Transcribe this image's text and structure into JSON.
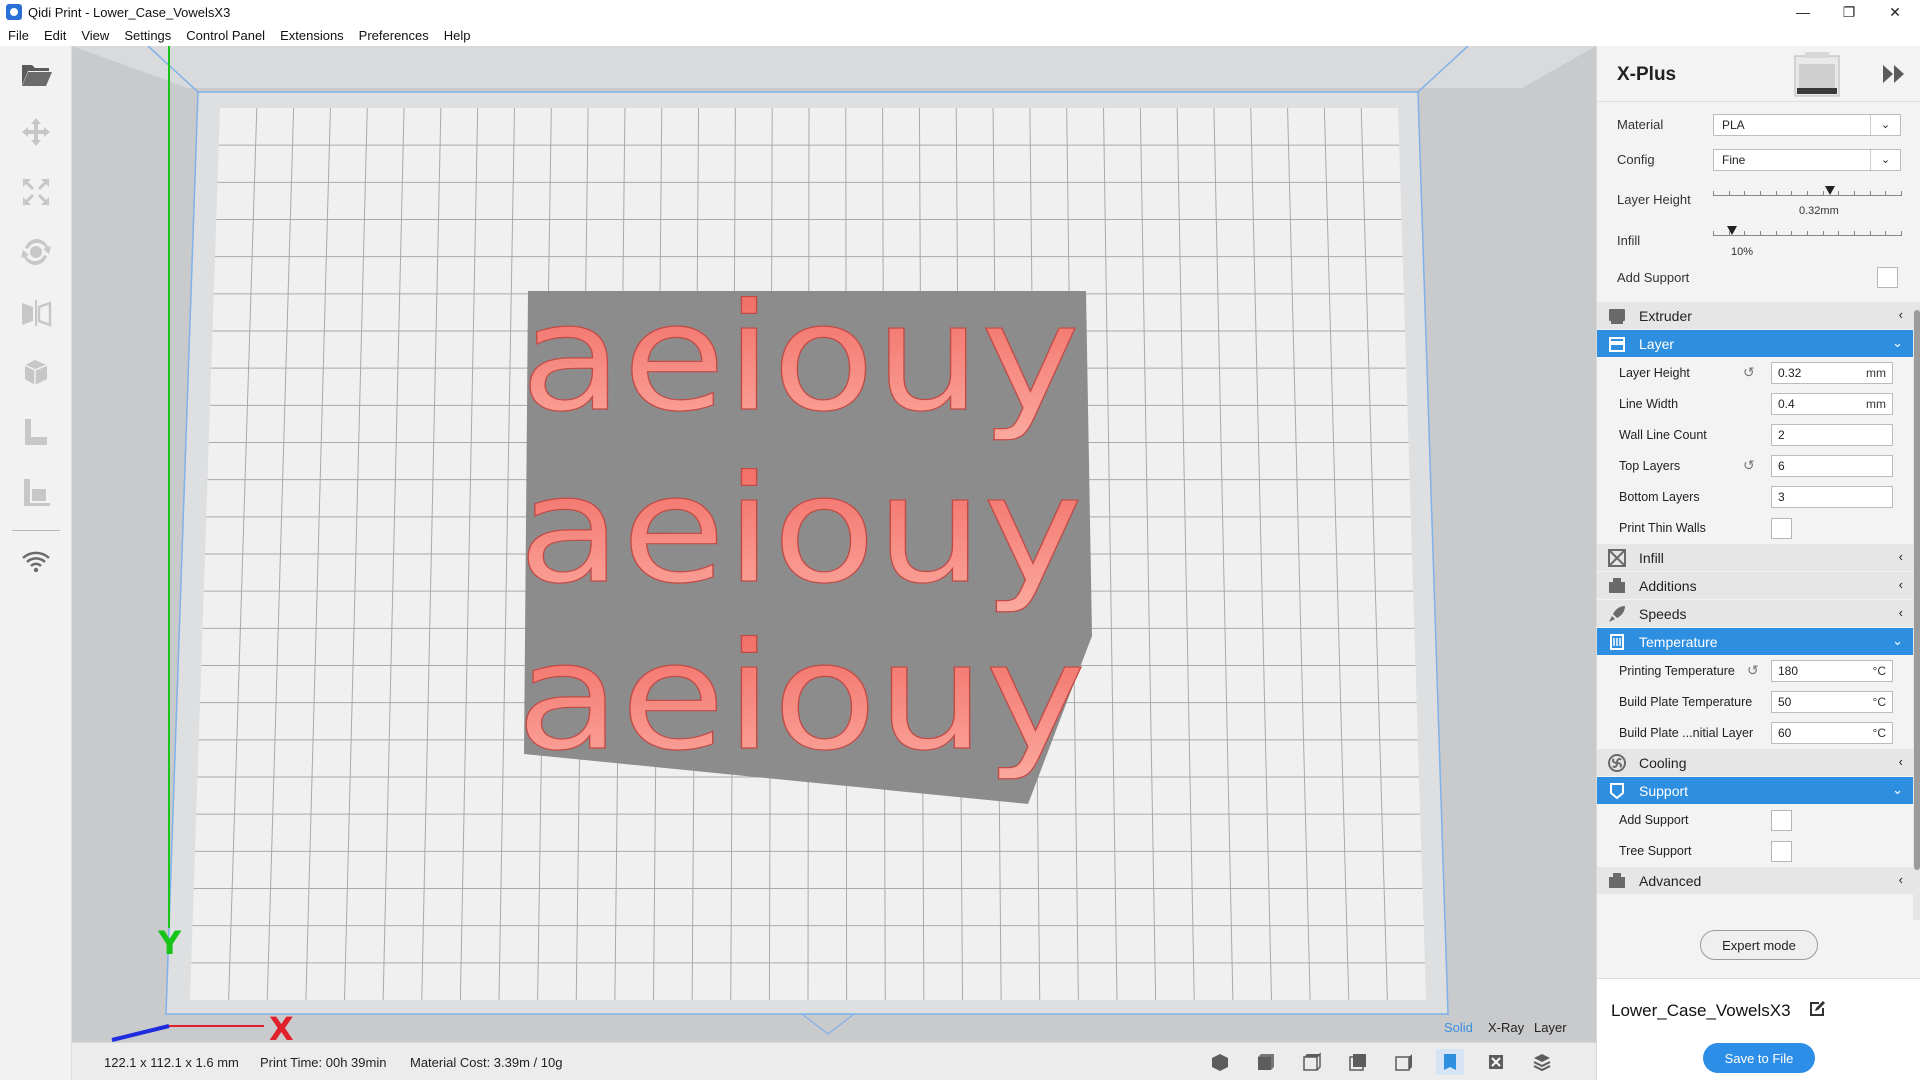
{
  "window": {
    "title": "Qidi Print - Lower_Case_VowelsX3",
    "minimize": "—",
    "maximize": "❐",
    "close": "✕"
  },
  "menu": [
    "File",
    "Edit",
    "View",
    "Settings",
    "Control Panel",
    "Extensions",
    "Preferences",
    "Help"
  ],
  "left_toolbar": [
    "open-folder-icon",
    "move-icon",
    "scale-icon",
    "rotate-icon",
    "mirror-icon",
    "per-model-settings-icon",
    "support-blocker-icon",
    "lay-flat-icon",
    "wifi-icon"
  ],
  "scene": {
    "model_text_rows": [
      "aeiouy",
      "aeiouy",
      "aeiouy"
    ],
    "axis_y_label": "Y",
    "axis_x_label": "X",
    "colors": {
      "model_base": "#8c8c8c",
      "model_text": "#f1665e",
      "axis_y": "#19c419",
      "axis_x": "#e0202a",
      "axis_z": "#1e2ce0",
      "build_volume_edge": "#6fa5e6"
    }
  },
  "view_modes": {
    "solid": "Solid",
    "xray": "X-Ray",
    "layer": "Layer"
  },
  "status": {
    "dimensions": "122.1 x 112.1 x 1.6 mm",
    "print_time": "Print Time: 00h 39min",
    "material_cost": "Material Cost: 3.39m / 10g"
  },
  "camera_buttons": [
    "3d-view-icon",
    "front-view-icon",
    "top-view-icon",
    "left-view-icon",
    "right-view-icon",
    "solid-view-icon",
    "xray-view-icon",
    "layer-view-icon"
  ],
  "panel": {
    "printer": "X-Plus",
    "basic": {
      "material_label": "Material",
      "material_value": "PLA",
      "config_label": "Config",
      "config_value": "Fine",
      "layer_height_label": "Layer Height",
      "layer_height_value": "0.32mm",
      "layer_height_fraction": 0.62,
      "infill_label": "Infill",
      "infill_value": "10%",
      "infill_fraction": 0.1,
      "add_support_label": "Add Support"
    },
    "categories": {
      "extruder": "Extruder",
      "layer": "Layer",
      "infill": "Infill",
      "additions": "Additions",
      "speeds": "Speeds",
      "temperature": "Temperature",
      "cooling": "Cooling",
      "support": "Support",
      "advanced": "Advanced"
    },
    "layer_settings": [
      {
        "label": "Layer Height",
        "value": "0.32",
        "unit": "mm"
      },
      {
        "label": "Line Width",
        "value": "0.4",
        "unit": "mm"
      },
      {
        "label": "Wall Line Count",
        "value": "2",
        "unit": ""
      },
      {
        "label": "Top Layers",
        "value": "6",
        "unit": ""
      },
      {
        "label": "Bottom Layers",
        "value": "3",
        "unit": ""
      },
      {
        "label": "Print Thin Walls"
      }
    ],
    "temperature_settings": [
      {
        "label": "Printing Temperature",
        "value": "180",
        "unit": "°C"
      },
      {
        "label": "Build Plate Temperature",
        "value": "50",
        "unit": "°C"
      },
      {
        "label": "Build Plate ...nitial Layer",
        "value": "60",
        "unit": "°C"
      }
    ],
    "support_settings": [
      {
        "label": "Add Support"
      },
      {
        "label": "Tree Support"
      }
    ],
    "expert_mode": "Expert mode",
    "filename": "Lower_Case_VowelsX3",
    "save": "Save to File"
  }
}
